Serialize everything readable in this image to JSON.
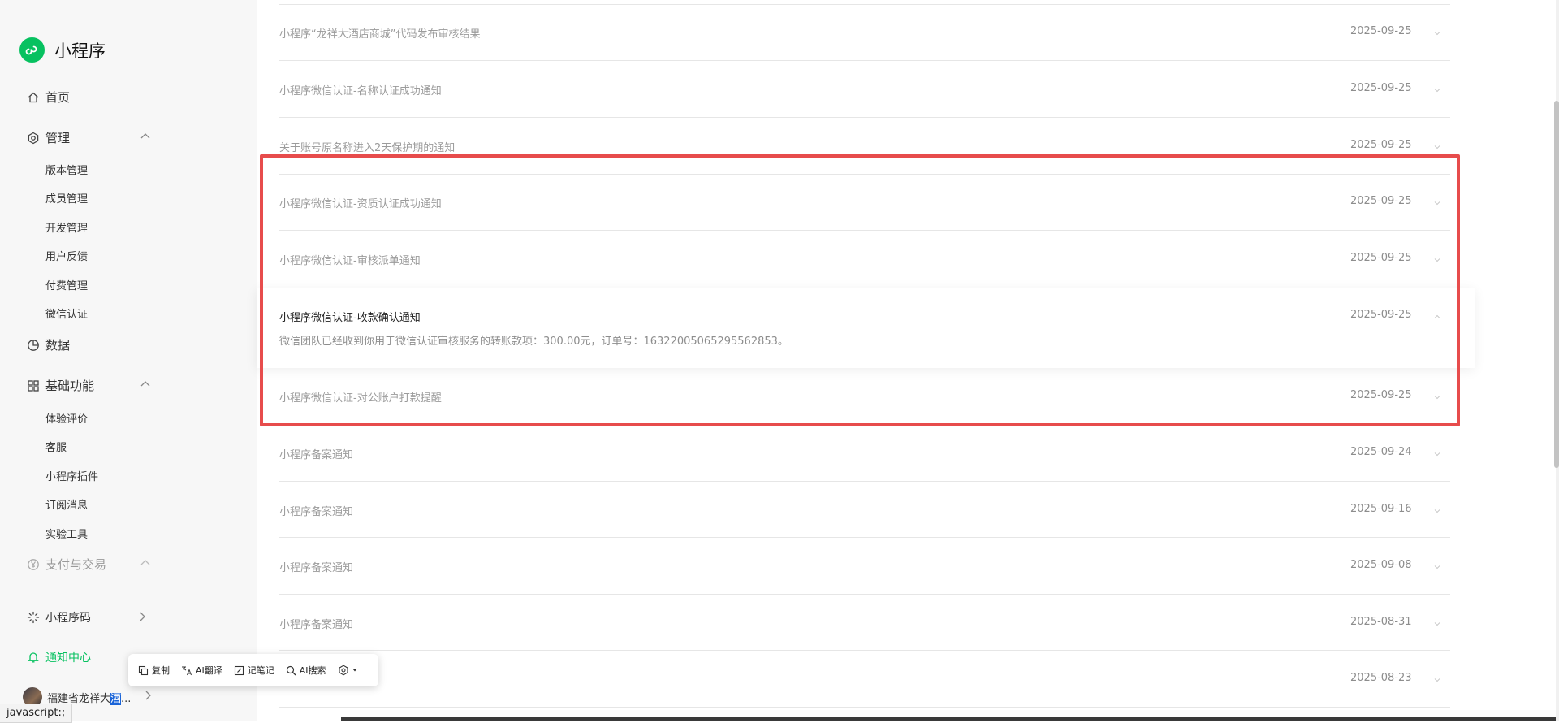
{
  "brand": {
    "name": "小程序"
  },
  "sidebar": {
    "home": "首页",
    "manage": {
      "label": "管理",
      "items": [
        "版本管理",
        "成员管理",
        "开发管理",
        "用户反馈",
        "付费管理",
        "微信认证"
      ]
    },
    "data": "数据",
    "basic": {
      "label": "基础功能",
      "items": [
        "体验评价",
        "客服",
        "小程序插件",
        "订阅消息",
        "实验工具"
      ]
    },
    "payment": "支付与交易",
    "qrcode": "小程序码",
    "notify": "通知中心",
    "account": {
      "name_prefix": "福建省龙祥大",
      "name_selected": "酒",
      "name_suffix": "..."
    }
  },
  "notifications": [
    {
      "title": "小程序“龙祥大酒店商城”代码发布审核结果",
      "date": "2025-09-25"
    },
    {
      "title": "小程序微信认证-名称认证成功通知",
      "date": "2025-09-25"
    },
    {
      "title": "关于账号原名称进入2天保护期的通知",
      "date": "2025-09-25"
    },
    {
      "title": "小程序微信认证-资质认证成功通知",
      "date": "2025-09-25"
    },
    {
      "title": "小程序微信认证-审核派单通知",
      "date": "2025-09-25"
    },
    {
      "title": "小程序微信认证-收款确认通知",
      "date": "2025-09-25",
      "detail": "微信团队已经收到你用于微信认证审核服务的转账款项：300.00元，订单号：16322005065295562853。"
    },
    {
      "title": "小程序微信认证-对公账户打款提醒",
      "date": "2025-09-25"
    },
    {
      "title": "小程序备案通知",
      "date": "2025-09-24"
    },
    {
      "title": "小程序备案通知",
      "date": "2025-09-16"
    },
    {
      "title": "小程序备案通知",
      "date": "2025-09-08"
    },
    {
      "title": "小程序备案通知",
      "date": "2025-08-31"
    },
    {
      "title": "",
      "date": "2025-08-23"
    }
  ],
  "toolbar": {
    "copy": "复制",
    "translate": "AI翻译",
    "note": "记笔记",
    "search": "AI搜索"
  },
  "status_bar": "javascript:;",
  "colors": {
    "brand_green": "#07c160",
    "highlight_red": "#e74c4c"
  }
}
